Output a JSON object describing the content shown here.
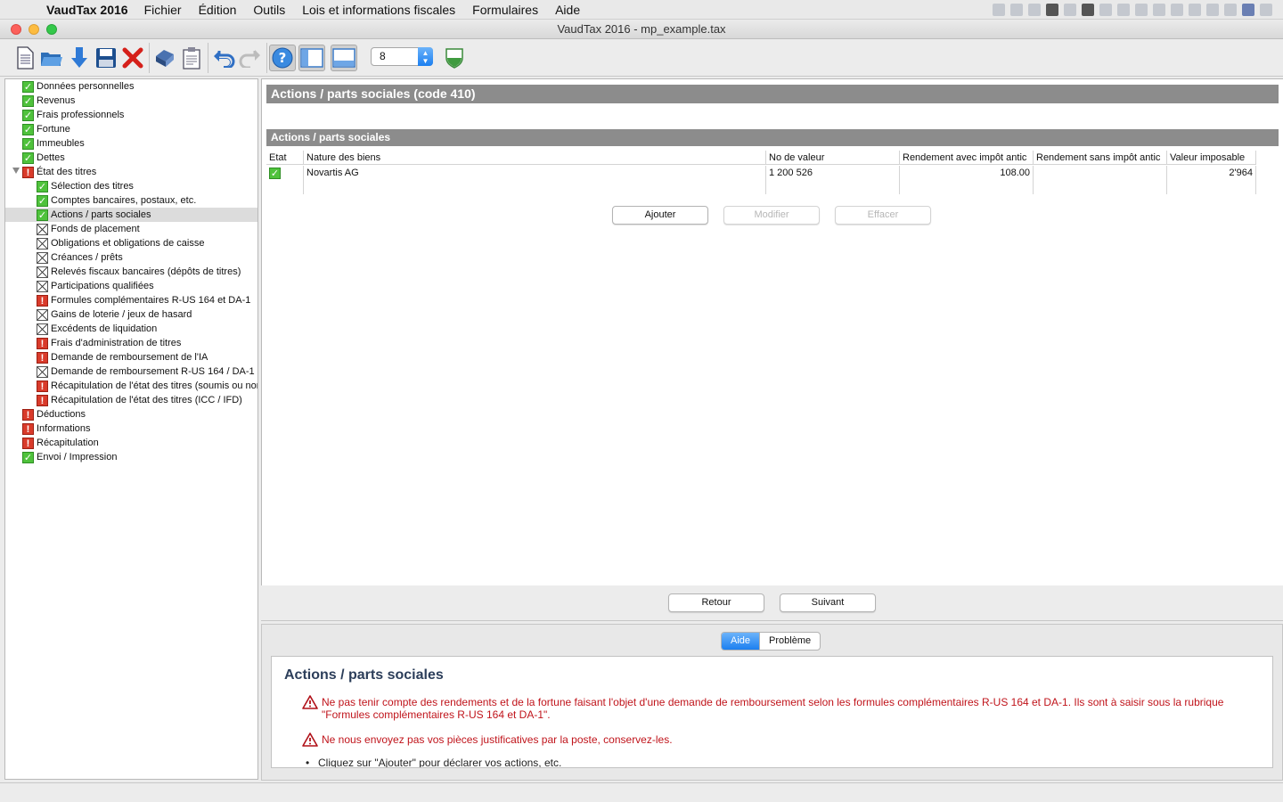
{
  "menubar": {
    "app_name": "VaudTax 2016",
    "items": [
      "Fichier",
      "Édition",
      "Outils",
      "Lois et informations fiscales",
      "Formulaires",
      "Aide"
    ]
  },
  "window": {
    "title": "VaudTax 2016 - mp_example.tax"
  },
  "toolbar": {
    "zoom_value": "8"
  },
  "tree": [
    {
      "label": "Données personnelles",
      "status": "ok",
      "level": 0
    },
    {
      "label": "Revenus",
      "status": "ok",
      "level": 0
    },
    {
      "label": "Frais professionnels",
      "status": "ok",
      "level": 0
    },
    {
      "label": "Fortune",
      "status": "ok",
      "level": 0
    },
    {
      "label": "Immeubles",
      "status": "ok",
      "level": 0
    },
    {
      "label": "Dettes",
      "status": "ok",
      "level": 0
    },
    {
      "label": "État des titres",
      "status": "err",
      "level": 0,
      "expanded": true
    },
    {
      "label": "Sélection des titres",
      "status": "ok",
      "level": 1
    },
    {
      "label": "Comptes bancaires, postaux, etc.",
      "status": "ok",
      "level": 1
    },
    {
      "label": "Actions / parts sociales",
      "status": "ok",
      "level": 1,
      "selected": true
    },
    {
      "label": "Fonds de placement",
      "status": "na",
      "level": 1
    },
    {
      "label": "Obligations et obligations de caisse",
      "status": "na",
      "level": 1
    },
    {
      "label": "Créances / prêts",
      "status": "na",
      "level": 1
    },
    {
      "label": "Relevés fiscaux bancaires (dépôts de titres)",
      "status": "na",
      "level": 1
    },
    {
      "label": "Participations qualifiées",
      "status": "na",
      "level": 1
    },
    {
      "label": "Formules complémentaires R-US 164 et DA-1",
      "status": "err",
      "level": 1
    },
    {
      "label": "Gains de loterie / jeux de hasard",
      "status": "na",
      "level": 1
    },
    {
      "label": "Excédents de liquidation",
      "status": "na",
      "level": 1
    },
    {
      "label": "Frais d'administration de titres",
      "status": "err",
      "level": 1
    },
    {
      "label": "Demande de remboursement de l'IA",
      "status": "err",
      "level": 1
    },
    {
      "label": "Demande de remboursement R-US 164 / DA-1",
      "status": "na",
      "level": 1
    },
    {
      "label": "Récapitulation de l'état des titres (soumis ou non",
      "status": "err",
      "level": 1
    },
    {
      "label": "Récapitulation de l'état des titres (ICC / IFD)",
      "status": "err",
      "level": 1
    },
    {
      "label": "Déductions",
      "status": "err",
      "level": 0
    },
    {
      "label": "Informations",
      "status": "err",
      "level": 0
    },
    {
      "label": "Récapitulation",
      "status": "err",
      "level": 0
    },
    {
      "label": "Envoi / Impression",
      "status": "ok",
      "level": 0
    }
  ],
  "main": {
    "page_title": "Actions / parts sociales (code 410)",
    "section_title": "Actions / parts sociales",
    "columns": [
      "Etat",
      "Nature des biens",
      "No de valeur",
      "Rendement avec impôt antic",
      "Rendement sans impôt antic",
      "Valeur imposable"
    ],
    "rows": [
      {
        "status": "ok",
        "nature": "Novartis AG",
        "no_valeur": "1 200 526",
        "rendement_avec": "108.00",
        "rendement_sans": "",
        "valeur": "2'964"
      }
    ],
    "buttons": {
      "add": "Ajouter",
      "edit": "Modifier",
      "delete": "Effacer"
    }
  },
  "nav": {
    "back": "Retour",
    "next": "Suivant"
  },
  "help": {
    "tabs": [
      "Aide",
      "Problème"
    ],
    "title": "Actions / parts sociales",
    "warnings": [
      [
        "Ne pas tenir compte des rendements et de la fortune faisant l'objet d'une demande de remboursement selon les formules complémentaires R-US 164 et DA-1. Ils sont à saisir sous la rubrique",
        "\"Formules complémentaires R-US 164 et DA-1\"."
      ],
      [
        "Ne nous envoyez pas vos pièces justificatives par la poste, conservez-les."
      ]
    ],
    "bullet": "Cliquez sur \"Ajouter\" pour déclarer vos actions, etc."
  }
}
